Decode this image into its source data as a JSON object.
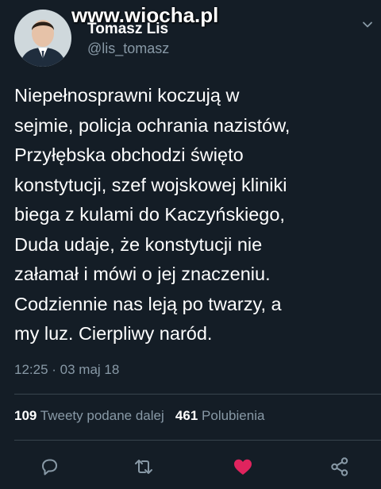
{
  "watermark": "www.wiocha.pl",
  "author": {
    "name": "Tomasz Lis",
    "handle": "@lis_tomasz"
  },
  "tweet": {
    "lines": [
      "Niepełnosprawni koczują w",
      "sejmie, policja ochrania nazistów,",
      "Przyłębska obchodzi święto",
      "konstytucji, szef wojskowej kliniki",
      "biega z kulami do Kaczyńskiego,",
      "Duda udaje, że konstytucji nie",
      "załamał i mówi o jej znaczeniu.",
      "Codziennie nas leją po twarzy, a",
      "my luz. Cierpliwy naród."
    ],
    "timestamp": "12:25 · 03 maj 18"
  },
  "stats": {
    "retweets_count": "109",
    "retweets_label": "Tweety podane dalej",
    "likes_count": "461",
    "likes_label": "Polubienia"
  },
  "icons": {
    "reply": "reply-icon",
    "retweet": "retweet-icon",
    "like": "heart-icon",
    "share": "share-icon",
    "menu": "chevron-down-icon"
  },
  "colors": {
    "background": "#141d26",
    "secondary_text": "#8899a6",
    "like_active": "#e0245e"
  }
}
